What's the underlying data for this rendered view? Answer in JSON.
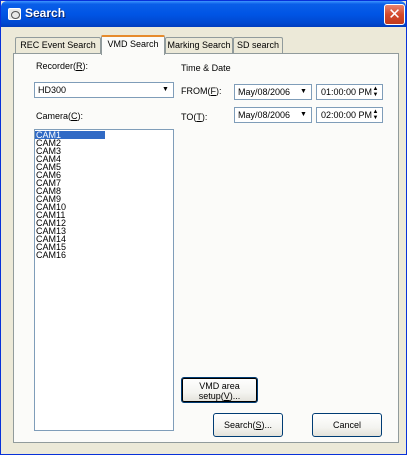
{
  "window": {
    "title": "Search",
    "close_glyph": "✕"
  },
  "tabs": [
    {
      "label": "REC Event Search",
      "active": false
    },
    {
      "label": "VMD Search",
      "active": true
    },
    {
      "label": "Marking Search",
      "active": false
    },
    {
      "label": "SD search",
      "active": false
    }
  ],
  "recorder": {
    "label_pre": "Recorder(",
    "accel": "R",
    "label_post": "):",
    "value": "HD300"
  },
  "camera": {
    "label_pre": "Camera(",
    "accel": "C",
    "label_post": "):",
    "items": [
      "CAM1",
      "CAM2",
      "CAM3",
      "CAM4",
      "CAM5",
      "CAM6",
      "CAM7",
      "CAM8",
      "CAM9",
      "CAM10",
      "CAM11",
      "CAM12",
      "CAM13",
      "CAM14",
      "CAM15",
      "CAM16"
    ],
    "selected": "CAM1"
  },
  "time_date": {
    "heading": "Time & Date",
    "from": {
      "label_pre": "FROM(",
      "accel": "F",
      "label_post": "):",
      "date": "May/08/2006",
      "time": "01:00:00 PM"
    },
    "to": {
      "label_pre": "TO(",
      "accel": "T",
      "label_post": "):",
      "date": "May/08/2006",
      "time": "02:00:00 PM"
    }
  },
  "buttons": {
    "vmd_area_line1": "VMD area",
    "vmd_area_line2_pre": "setup(",
    "vmd_area_accel": "V",
    "vmd_area_line2_post": ")...",
    "search_pre": "Search(",
    "search_accel": "S",
    "search_post": ")...",
    "cancel": "Cancel"
  },
  "icons": {
    "dropdown": "▼",
    "spin_up": "▲",
    "spin_down": "▼"
  }
}
